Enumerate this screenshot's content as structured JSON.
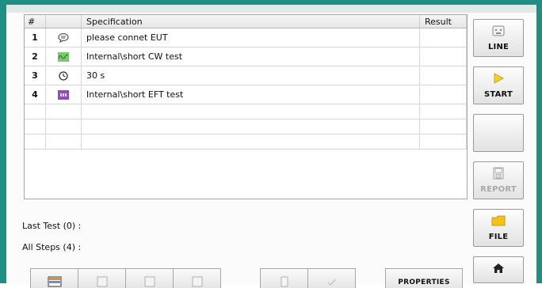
{
  "steps_table": {
    "columns": {
      "num": "#",
      "specification": "Specification",
      "result": "Result"
    },
    "rows": [
      {
        "num": "1",
        "icon": "speech-bubble-icon",
        "spec": "please connet EUT",
        "result": ""
      },
      {
        "num": "2",
        "icon": "cw-waveform-icon",
        "spec": "Internal\\short CW test",
        "result": ""
      },
      {
        "num": "3",
        "icon": "clock-icon",
        "spec": "30 s",
        "result": ""
      },
      {
        "num": "4",
        "icon": "eft-burst-icon",
        "spec": "Internal\\short EFT test",
        "result": ""
      }
    ],
    "empty_row_count": 3
  },
  "status": {
    "last_test": "Last Test (0) :",
    "all_steps": "All Steps (4) :"
  },
  "side_buttons": {
    "line": "LINE",
    "start": "START",
    "blank": "",
    "report": "REPORT",
    "file": "FILE"
  },
  "bottom_toolbar": {
    "properties": "PROPERTIES"
  },
  "colors": {
    "frame": "#1f8f84",
    "start_arrow": "#f2d12c",
    "file_folder": "#f4c21b",
    "cw_icon": "#7bc96d",
    "eft_icon": "#8f4fb3"
  }
}
